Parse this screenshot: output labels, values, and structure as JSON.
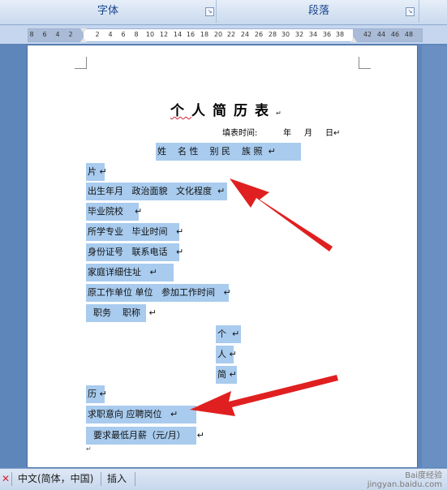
{
  "ribbon": {
    "groups": [
      {
        "label": "字体"
      },
      {
        "label": "段落"
      }
    ]
  },
  "ruler": {
    "ticks": [
      "8",
      "6",
      "4",
      "2",
      "2",
      "4",
      "6",
      "8",
      "10",
      "12",
      "14",
      "16",
      "18",
      "20",
      "22",
      "24",
      "26",
      "28",
      "30",
      "32",
      "34",
      "36",
      "38",
      "42",
      "44",
      "46",
      "48"
    ]
  },
  "document": {
    "title_chars": [
      "个",
      "人",
      "简",
      "历",
      "表"
    ],
    "title_end_mark": "↵",
    "fill_time_line": "填表时间:          年     月     日↵",
    "lines": [
      {
        "text": "姓    名 性    别 民    族 照  ↵"
      },
      {
        "text": "片 ↵"
      },
      {
        "text": "出生年月   政治面貌   文化程度  ↵"
      },
      {
        "text": "毕业院校    ↵"
      },
      {
        "text": "所学专业   毕业时间   ↵"
      },
      {
        "text": "身份证号   联系电话   ↵"
      },
      {
        "text": "家庭详细住址   ↵"
      },
      {
        "text": "原工作单位 单位   参加工作时间   ↵"
      },
      {
        "text": "  职务    职称   ↵"
      },
      {
        "text": "个  ↵"
      },
      {
        "text": "人 ↵"
      },
      {
        "text": "简 ↵"
      },
      {
        "text": "历 ↵"
      },
      {
        "text": "求职意向 应聘岗位   ↵"
      },
      {
        "text": "  要求最低月薪（元/月）    ↵"
      },
      {
        "text": "↵"
      }
    ]
  },
  "status_bar": {
    "language": "中文(简体，中国)",
    "mode": "插入"
  },
  "watermark": {
    "line1": "Bai度经验",
    "line2": "jingyan.baidu.com"
  },
  "colors": {
    "selection": "#a8cbee",
    "arrow": "#e02020",
    "ribbon_text": "#15428b"
  }
}
